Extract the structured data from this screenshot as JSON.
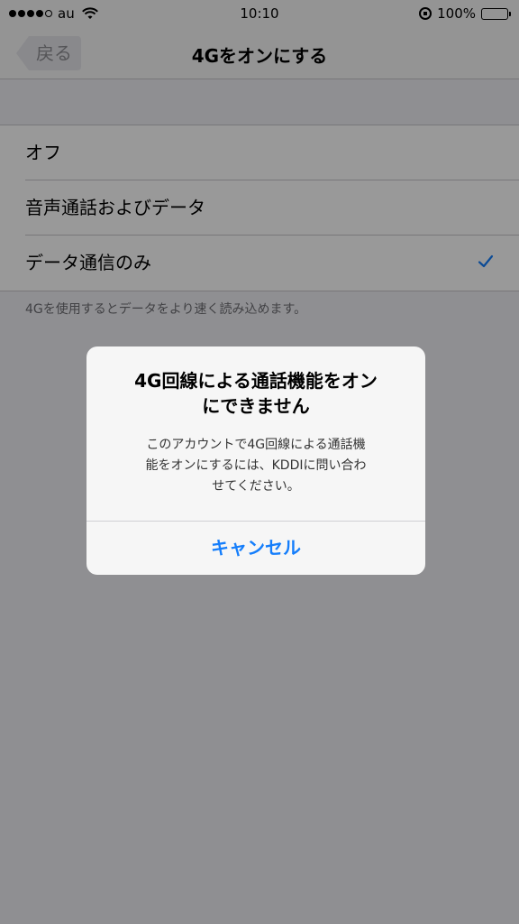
{
  "status_bar": {
    "carrier": "au",
    "time": "10:10",
    "battery": "100%",
    "signal_bars_filled": 4,
    "signal_bars_total": 5
  },
  "nav": {
    "back_label": "戻る",
    "title": "4Gをオンにする"
  },
  "options": [
    {
      "label": "オフ",
      "checked": false
    },
    {
      "label": "音声通話およびデータ",
      "checked": false
    },
    {
      "label": "データ通信のみ",
      "checked": true
    }
  ],
  "footer_note": "4Gを使用するとデータをより速く読み込めます。",
  "alert": {
    "title_line1": "4G回線による通話機能をオン",
    "title_line2": "にできません",
    "message_line1": "このアカウントで4G回線による通話機",
    "message_line2": "能をオンにするには、KDDIに問い合わ",
    "message_line3": "せてください。",
    "cancel_label": "キャンセル"
  },
  "colors": {
    "accent": "#157efb",
    "overlay": "rgba(0,0,0,0.4)"
  },
  "icons": [
    "wifi-icon",
    "orientation-lock-icon",
    "battery-icon",
    "back-arrow-icon",
    "checkmark-icon"
  ]
}
